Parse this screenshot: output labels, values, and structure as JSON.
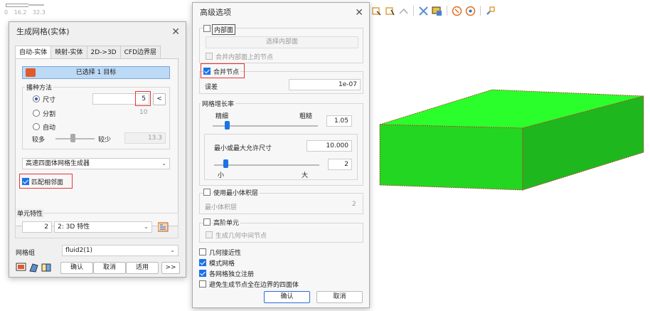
{
  "ruler": {
    "ticks": [
      "0",
      "16.2",
      "32.3"
    ]
  },
  "toolbar": {
    "icons": [
      "select-face-icon",
      "select-edge-icon",
      "select-body-icon",
      "hide-icon",
      "view-icon",
      "info-icon",
      "measure-icon",
      "link-icon"
    ]
  },
  "colors": {
    "box_green": "#22e022",
    "accent_blue": "#1a73e8",
    "highlight_red": "#e33333"
  },
  "left_dialog": {
    "title": "生成网格(实体)",
    "tabs": [
      "自动-实体",
      "映射-实体",
      "2D->3D",
      "CFD边界层"
    ],
    "target_label": "已选择 1 目标",
    "seed_method": {
      "label": "播种方法",
      "size_label": "尺寸",
      "size_value": "5",
      "size_btn": "<",
      "divide_label": "分割",
      "divide_value": "10",
      "auto_label": "自动",
      "more_label": "较多",
      "less_label": "较少",
      "auto_value": "13.3"
    },
    "generator": "高速四面体网格生成器",
    "match_adjacent": "匹配相邻面",
    "element_props": {
      "label": "单元特性",
      "value": "2",
      "type": "2: 3D 特性"
    },
    "mesh_group": {
      "label": "网格组",
      "value": "fluid2(1)"
    },
    "buttons": {
      "ok": "确认",
      "cancel": "取消",
      "apply": "适用",
      "more": ">>"
    }
  },
  "right_dialog": {
    "title": "高级选项",
    "inner_face": {
      "label": "内部面",
      "select_btn": "选择内部面",
      "merge_nodes_inner": "合并内部面上的节点"
    },
    "merge_nodes": {
      "label": "合并节点",
      "tol_label": "误差",
      "tol_value": "1e-07"
    },
    "growth": {
      "label": "网格增长率",
      "fine": "精细",
      "coarse": "粗糙",
      "value": "1.05",
      "max_min_label": "最小或最大允许尺寸",
      "max_min_value": "10.000",
      "small": "小",
      "big": "大",
      "ratio_value": "2"
    },
    "min_volume": {
      "label": "使用最小体积层",
      "field_label": "最小体积层",
      "value": "2"
    },
    "high_order": {
      "label": "高阶单元",
      "geo_mid": "生成几何中间节点"
    },
    "options": [
      "几何接近性",
      "模式网格",
      "各网格独立注册",
      "避免生成节点全在边界的四面体"
    ],
    "buttons": {
      "ok": "确认",
      "cancel": "取消"
    }
  }
}
